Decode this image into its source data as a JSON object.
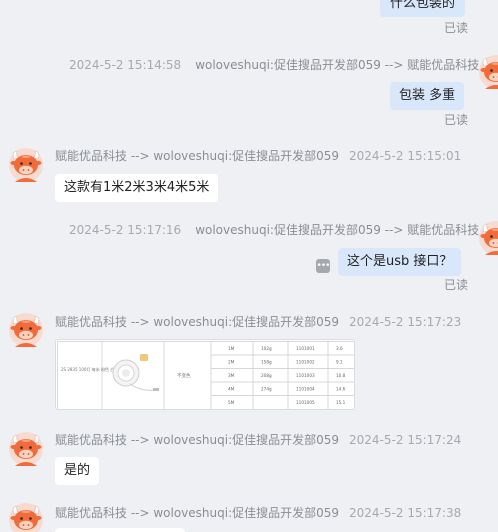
{
  "messages": [
    {
      "dir": "out",
      "text": "什么包装的",
      "read": "已读"
    },
    {
      "dir": "out",
      "sender": "woloveshuqi:促佳搜品开发部059 --> 赋能优品科技",
      "time": "2024-5-2 15:14:58",
      "text": "包装 多重",
      "read": "已读"
    },
    {
      "dir": "in",
      "sender": "赋能优品科技 --> woloveshuqi:促佳搜品开发部059",
      "time": "2024-5-2 15:15:01",
      "text": "这款有1米2米3米4米5米"
    },
    {
      "dir": "out",
      "sender": "woloveshuqi:促佳搜品开发部059 --> 赋能优品科技",
      "time": "2024-5-2 15:17:16",
      "text": "这个是usb  接口？",
      "read": "已读"
    },
    {
      "dir": "in",
      "sender": "赋能优品科技 --> woloveshuqi:促佳搜品开发部059",
      "time": "2024-5-2 15:17:23",
      "image": {
        "title_cell": "2S 2835 100灯 每米 粉色 白灯",
        "mode_cell": "不变色",
        "rows": [
          [
            "1M",
            "102g",
            "1101001",
            "3.6"
          ],
          [
            "2M",
            "158g",
            "1101002",
            "9.1"
          ],
          [
            "3M",
            "208g",
            "1101003",
            "10.8"
          ],
          [
            "4M",
            "274g",
            "1101004",
            "14.6"
          ],
          [
            "5M",
            "",
            "1101005",
            "15.1"
          ]
        ]
      }
    },
    {
      "dir": "in",
      "sender": "赋能优品科技 --> woloveshuqi:促佳搜品开发部059",
      "time": "2024-5-2 15:17:24",
      "text": "是的"
    },
    {
      "dir": "in",
      "sender": "赋能优品科技 --> woloveshuqi:促佳搜品开发部059",
      "time": "2024-5-2 15:17:38"
    }
  ]
}
